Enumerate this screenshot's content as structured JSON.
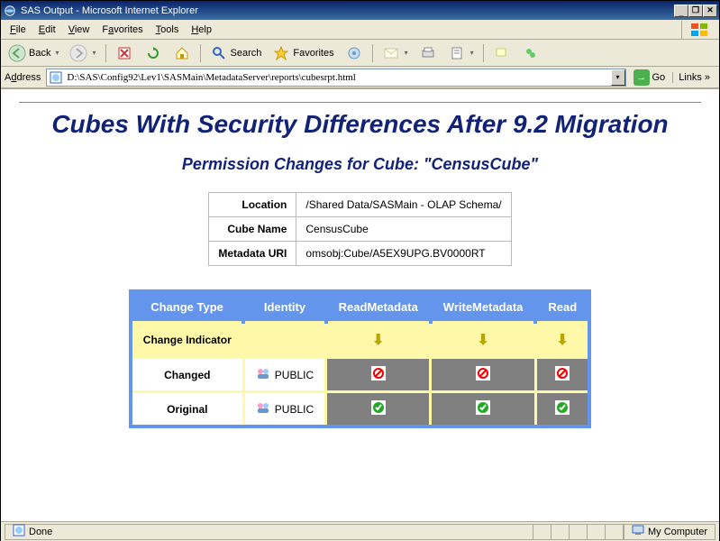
{
  "window": {
    "title": "SAS Output - Microsoft Internet Explorer",
    "min_btn": "_",
    "max_btn": "□",
    "close_btn": "×"
  },
  "menu": {
    "file": "File",
    "edit": "Edit",
    "view": "View",
    "favorites": "Favorites",
    "tools": "Tools",
    "help": "Help"
  },
  "toolbar": {
    "back": "Back",
    "search": "Search",
    "favorites": "Favorites"
  },
  "addressbar": {
    "label": "Address",
    "value": "D:\\SAS\\Config92\\Lev1\\SASMain\\MetadataServer\\reports\\cubesrpt.html",
    "go": "Go",
    "links": "Links"
  },
  "report": {
    "title": "Cubes With Security Differences After 9.2 Migration",
    "section": "Permission Changes for Cube: \"CensusCube\"",
    "info": {
      "location_label": "Location",
      "location_value": "/Shared Data/SASMain - OLAP Schema/",
      "cubename_label": "Cube Name",
      "cubename_value": "CensusCube",
      "uri_label": "Metadata URI",
      "uri_value": "omsobj:Cube/A5EX9UPG.BV0000RT"
    },
    "perm": {
      "headers": {
        "change_type": "Change Type",
        "identity": "Identity",
        "read_metadata": "ReadMetadata",
        "write_metadata": "WriteMetadata",
        "read": "Read"
      },
      "rows": {
        "indicator_label": "Change Indicator",
        "changed_label": "Changed",
        "original_label": "Original",
        "identity_changed": "PUBLIC",
        "identity_original": "PUBLIC"
      }
    }
  },
  "statusbar": {
    "done": "Done",
    "zone": "My Computer"
  },
  "icons": {
    "down_arrow": "⬇",
    "chevron": "»"
  }
}
